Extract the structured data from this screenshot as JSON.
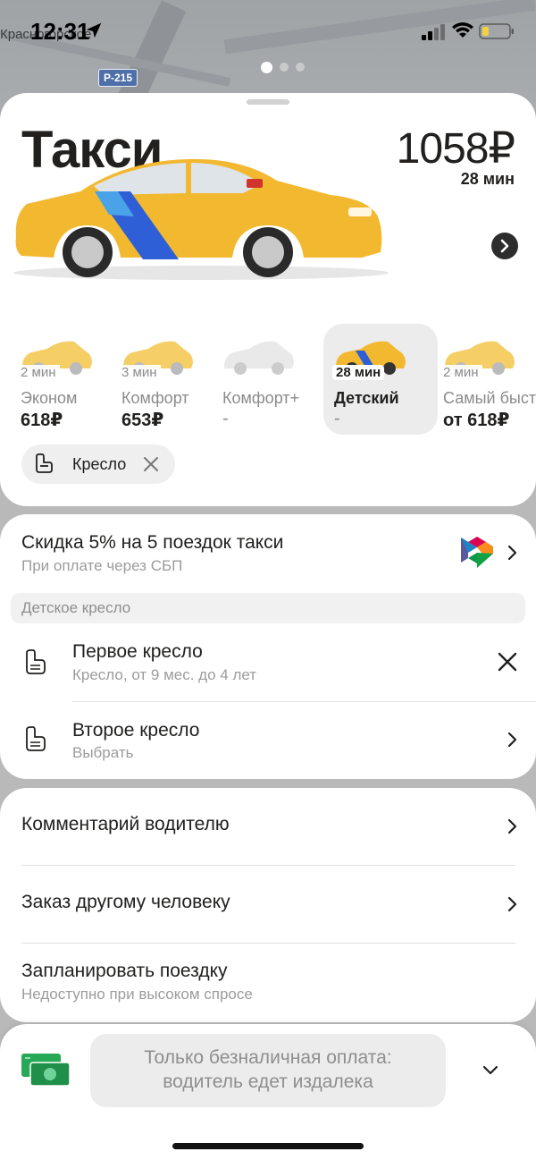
{
  "status_bar": {
    "time": "12:31",
    "map_label": "Красногорское",
    "road_badge": "Р-215"
  },
  "header": {
    "title": "Такси",
    "price": "1058₽",
    "eta": "28 мин"
  },
  "tariffs": [
    {
      "eta": "2 мин",
      "name": "Эконом",
      "price": "618₽",
      "selected": false
    },
    {
      "eta": "3 мин",
      "name": "Комфорт",
      "price": "653₽",
      "selected": false
    },
    {
      "eta": "",
      "name": "Комфорт+",
      "price": "-",
      "selected": false
    },
    {
      "eta": "28 мин",
      "name": "Детский",
      "price": "-",
      "selected": true
    },
    {
      "eta": "2 мин",
      "name": "Самый быст",
      "price": "от 618₽",
      "selected": false
    }
  ],
  "chip": {
    "label": "Кресло"
  },
  "promo": {
    "title": "Скидка 5% на 5 поездок такси",
    "subtitle": "При оплате через СБП"
  },
  "child_seat_section": {
    "header": "Детское кресло",
    "items": [
      {
        "title": "Первое кресло",
        "subtitle": "Кресло, от 9 мес. до 4 лет"
      },
      {
        "title": "Второе кресло",
        "subtitle": "Выбрать"
      }
    ]
  },
  "options": [
    {
      "title": "Комментарий водителю",
      "subtitle": ""
    },
    {
      "title": "Заказ другому человеку",
      "subtitle": ""
    },
    {
      "title": "Запланировать поездку",
      "subtitle": "Недоступно при высоком спросе"
    }
  ],
  "payment": {
    "button_line1": "Только безналичная оплата:",
    "button_line2": "водитель едет издалека"
  },
  "colors": {
    "taxi_yellow": "#f2b830",
    "brand_blue": "#2e5fd6",
    "text": "#21201f",
    "secondary_text": "#9c9c9c"
  },
  "icons": [
    "location-arrow-icon",
    "signal-icon",
    "wifi-icon",
    "battery-icon",
    "chevron-right-icon",
    "car-seat-icon",
    "close-icon",
    "sbp-logo-icon",
    "money-icon",
    "chevron-down-icon"
  ]
}
